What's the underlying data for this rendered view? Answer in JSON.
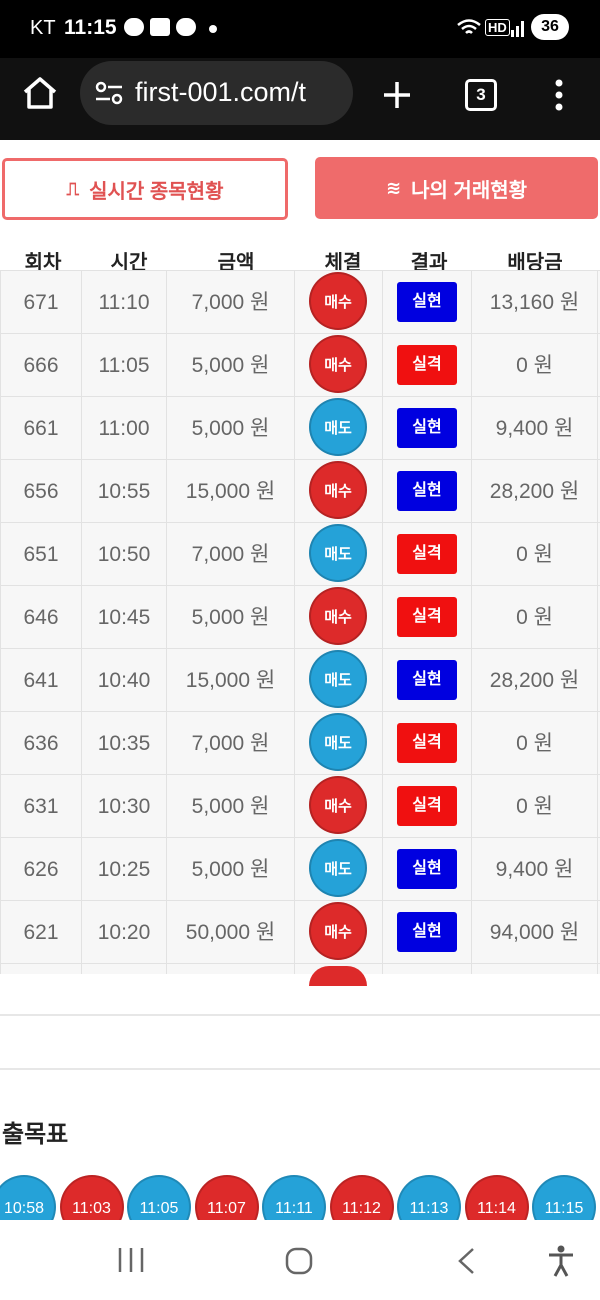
{
  "status_bar": {
    "carrier": "KT",
    "time": "11:15",
    "battery": "36",
    "notification_icons": [
      "chat-bubble-icon",
      "smile-icon",
      "talk-icon"
    ],
    "system_icons": [
      "wifi-icon",
      "hd-icon",
      "signal-icon"
    ]
  },
  "browser": {
    "url": "first-001.com/t",
    "tab_count": "3",
    "icons": [
      "home-icon",
      "site-settings-icon",
      "new-tab-plus-icon",
      "tab-switcher-icon",
      "overflow-menu-icon"
    ]
  },
  "buttons": {
    "live_label": "실시간 종목현황",
    "mine_label": "나의 거래현황",
    "live_icon": "pulse-icon",
    "mine_icon": "waves-icon"
  },
  "table": {
    "headers": [
      "회차",
      "시간",
      "금액",
      "체결",
      "결과",
      "배당금"
    ],
    "rows": [
      {
        "round": "671",
        "time": "11:10",
        "amount": "7,000 원",
        "trade": "매수",
        "trade_type": "buy",
        "result": "실현",
        "result_type": "win",
        "payout": "13,160 원"
      },
      {
        "round": "666",
        "time": "11:05",
        "amount": "5,000 원",
        "trade": "매수",
        "trade_type": "buy",
        "result": "실격",
        "result_type": "lose",
        "payout": "0 원"
      },
      {
        "round": "661",
        "time": "11:00",
        "amount": "5,000 원",
        "trade": "매도",
        "trade_type": "sell",
        "result": "실현",
        "result_type": "win",
        "payout": "9,400 원"
      },
      {
        "round": "656",
        "time": "10:55",
        "amount": "15,000 원",
        "trade": "매수",
        "trade_type": "buy",
        "result": "실현",
        "result_type": "win",
        "payout": "28,200 원"
      },
      {
        "round": "651",
        "time": "10:50",
        "amount": "7,000 원",
        "trade": "매도",
        "trade_type": "sell",
        "result": "실격",
        "result_type": "lose",
        "payout": "0 원"
      },
      {
        "round": "646",
        "time": "10:45",
        "amount": "5,000 원",
        "trade": "매수",
        "trade_type": "buy",
        "result": "실격",
        "result_type": "lose",
        "payout": "0 원"
      },
      {
        "round": "641",
        "time": "10:40",
        "amount": "15,000 원",
        "trade": "매도",
        "trade_type": "sell",
        "result": "실현",
        "result_type": "win",
        "payout": "28,200 원"
      },
      {
        "round": "636",
        "time": "10:35",
        "amount": "7,000 원",
        "trade": "매도",
        "trade_type": "sell",
        "result": "실격",
        "result_type": "lose",
        "payout": "0 원"
      },
      {
        "round": "631",
        "time": "10:30",
        "amount": "5,000 원",
        "trade": "매수",
        "trade_type": "buy",
        "result": "실격",
        "result_type": "lose",
        "payout": "0 원"
      },
      {
        "round": "626",
        "time": "10:25",
        "amount": "5,000 원",
        "trade": "매도",
        "trade_type": "sell",
        "result": "실현",
        "result_type": "win",
        "payout": "9,400 원"
      },
      {
        "round": "621",
        "time": "10:20",
        "amount": "50,000 원",
        "trade": "매수",
        "trade_type": "buy",
        "result": "실현",
        "result_type": "win",
        "payout": "94,000 원"
      }
    ]
  },
  "chart_section": {
    "title": "출목표",
    "chips": [
      {
        "time": "10:58",
        "type": "sell"
      },
      {
        "time": "11:03",
        "type": "buy"
      },
      {
        "time": "11:05",
        "type": "sell"
      },
      {
        "time": "11:07",
        "type": "buy"
      },
      {
        "time": "11:11",
        "type": "sell"
      },
      {
        "time": "11:12",
        "type": "buy"
      },
      {
        "time": "11:13",
        "type": "sell"
      },
      {
        "time": "11:14",
        "type": "buy"
      },
      {
        "time": "11:15",
        "type": "sell"
      }
    ]
  },
  "colors": {
    "buy": "#dd2a2a",
    "sell": "#25a2d8",
    "win": "#0000e0",
    "lose": "#f01010",
    "accent": "#ef6b6b"
  },
  "navbar": {
    "icons": [
      "recent-apps-icon",
      "home-circle-icon",
      "back-icon",
      "accessibility-icon"
    ]
  }
}
